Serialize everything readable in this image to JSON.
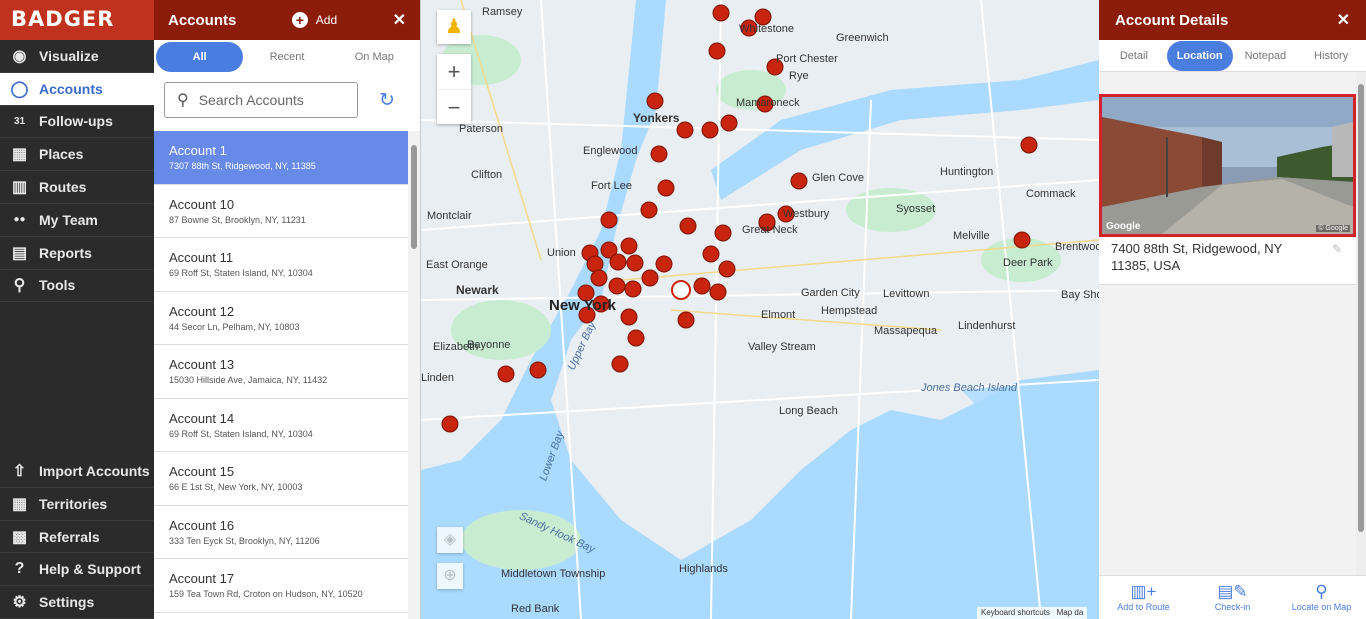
{
  "brand": "BADGER",
  "nav": {
    "items": [
      {
        "label": "Visualize",
        "icon": "eye-icon",
        "glyph": "◉"
      },
      {
        "label": "Accounts",
        "icon": "account-icon",
        "glyph": "◯"
      },
      {
        "label": "Follow-ups",
        "icon": "calendar-icon",
        "glyph": "31"
      },
      {
        "label": "Places",
        "icon": "store-icon",
        "glyph": "▦"
      },
      {
        "label": "Routes",
        "icon": "map-route-icon",
        "glyph": "▥"
      },
      {
        "label": "My Team",
        "icon": "team-icon",
        "glyph": "●●"
      },
      {
        "label": "Reports",
        "icon": "report-icon",
        "glyph": "▤"
      },
      {
        "label": "Tools",
        "icon": "tools-icon",
        "glyph": "⚲"
      }
    ],
    "bottom_items": [
      {
        "label": "Import Accounts",
        "icon": "import-icon",
        "glyph": "⇧"
      },
      {
        "label": "Territories",
        "icon": "territories-icon",
        "glyph": "▦"
      },
      {
        "label": "Referrals",
        "icon": "gift-icon",
        "glyph": "▩"
      },
      {
        "label": "Help & Support",
        "icon": "help-icon",
        "glyph": "?"
      },
      {
        "label": "Settings",
        "icon": "gear-icon",
        "glyph": "⚙"
      }
    ]
  },
  "accounts": {
    "title": "Accounts",
    "add_label": "Add",
    "tabs": [
      "All",
      "Recent",
      "On Map"
    ],
    "search_placeholder": "Search Accounts",
    "items": [
      {
        "name": "Account 1",
        "address": "7307 88th St, Ridgewood, NY, 11385"
      },
      {
        "name": "Account 10",
        "address": "87 Bowne St, Brooklyn, NY, 11231"
      },
      {
        "name": "Account 11",
        "address": "69 Roff St, Staten Island, NY, 10304"
      },
      {
        "name": "Account 12",
        "address": "44 Secor Ln, Pelham, NY, 10803"
      },
      {
        "name": "Account 13",
        "address": "15030 Hillside Ave, Jamaica, NY, 11432"
      },
      {
        "name": "Account 14",
        "address": "69 Roff St, Staten Island, NY, 10304"
      },
      {
        "name": "Account 15",
        "address": "66 E 1st St, New York, NY, 10003"
      },
      {
        "name": "Account 16",
        "address": "333 Ten Eyck St, Brooklyn, NY, 11206"
      },
      {
        "name": "Account 17",
        "address": "159 Tea Town Rd, Croton on Hudson, NY, 10520"
      }
    ]
  },
  "map": {
    "labels": [
      "Ramsey",
      "Greenwich",
      "Port Chester",
      "Rye",
      "Mamaroneck",
      "Yonkers",
      "Paterson",
      "Englewood",
      "Clifton",
      "Fort Lee",
      "Glen Cove",
      "Huntington",
      "Commack",
      "Montclair",
      "Syosset",
      "Melville",
      "Brentwood",
      "Union",
      "East Orange",
      "Newark",
      "New York",
      "Garden City",
      "Levittown",
      "Deer Park",
      "Hempstead",
      "Elizabeth",
      "Bayonne",
      "Valley Stream",
      "Massapequa",
      "Lindenhurst",
      "Linden",
      "Jones Beach Island",
      "Long Beach",
      "Middletown Township",
      "Highlands",
      "Red Bank",
      "Sandy Hook Bay",
      "Lower Bay",
      "Upper Bay",
      "Elmont",
      "Bay Shor",
      "Whitestone",
      "Great Neck",
      "Westbury"
    ],
    "footer_shortcuts": "Keyboard shortcuts",
    "footer_data": "Map da",
    "zoom_in": "+",
    "zoom_out": "−"
  },
  "details": {
    "title": "Account Details",
    "tabs": [
      "Detail",
      "Location",
      "Notepad",
      "History"
    ],
    "photo_brand": "Google",
    "photo_copyright": "© Google",
    "address_line1": "7400 88th St, Ridgewood, NY",
    "address_line2": "11385, USA",
    "footer": [
      {
        "label": "Add to Route",
        "icon": "route-add-icon",
        "glyph": "▥+"
      },
      {
        "label": "Check-in",
        "icon": "checkin-icon",
        "glyph": "▤✎"
      },
      {
        "label": "Locate on Map",
        "icon": "locate-icon",
        "glyph": "⚲"
      }
    ]
  },
  "colors": {
    "brand_red": "#c0321d",
    "header_dark_red": "#8b1c0a",
    "accent_blue": "#4a7de0",
    "selected_row": "#6789e8",
    "highlight_border": "#d2232a"
  }
}
